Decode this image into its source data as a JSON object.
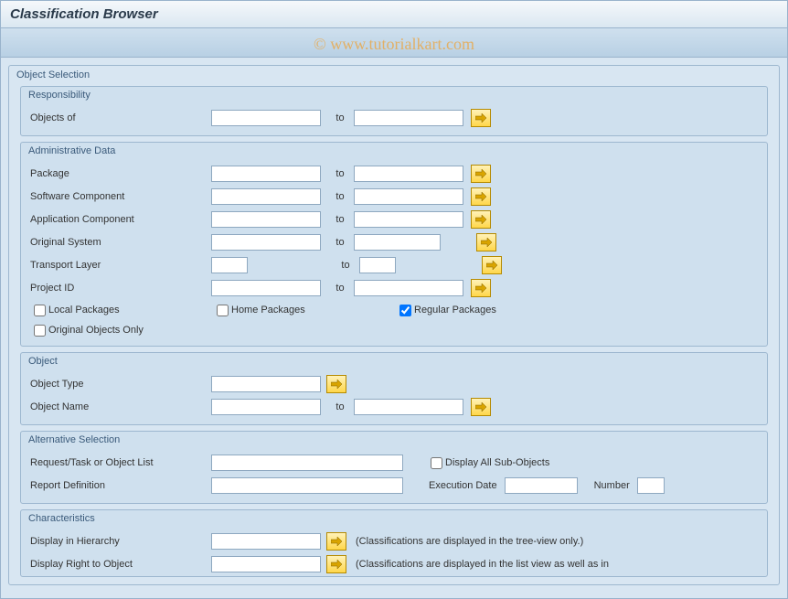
{
  "title": "Classification Browser",
  "watermark": "© www.tutorialkart.com",
  "object_selection": {
    "title": "Object Selection",
    "responsibility": {
      "title": "Responsibility",
      "objects_of_label": "Objects of",
      "to_label": "to"
    },
    "admin_data": {
      "title": "Administrative Data",
      "package_label": "Package",
      "software_component_label": "Software Component",
      "application_component_label": "Application Component",
      "original_system_label": "Original System",
      "transport_layer_label": "Transport Layer",
      "project_id_label": "Project ID",
      "to_label": "to",
      "local_packages_label": "Local Packages",
      "local_packages_checked": false,
      "home_packages_label": "Home Packages",
      "home_packages_checked": false,
      "regular_packages_label": "Regular Packages",
      "regular_packages_checked": true,
      "original_objects_only_label": "Original Objects Only",
      "original_objects_only_checked": false
    },
    "object": {
      "title": "Object",
      "object_type_label": "Object Type",
      "object_name_label": "Object Name",
      "to_label": "to"
    },
    "alternative_selection": {
      "title": "Alternative Selection",
      "request_task_label": "Request/Task or Object List",
      "display_all_sub_label": "Display All Sub-Objects",
      "display_all_sub_checked": false,
      "report_definition_label": "Report Definition",
      "execution_date_label": "Execution Date",
      "number_label": "Number"
    },
    "characteristics": {
      "title": "Characteristics",
      "display_in_hierarchy_label": "Display in Hierarchy",
      "display_in_hierarchy_note": "(Classifications are displayed in the tree-view only.)",
      "display_right_to_object_label": "Display Right to Object",
      "display_right_to_object_note": "(Classifications are displayed in the list view as well as in"
    }
  }
}
